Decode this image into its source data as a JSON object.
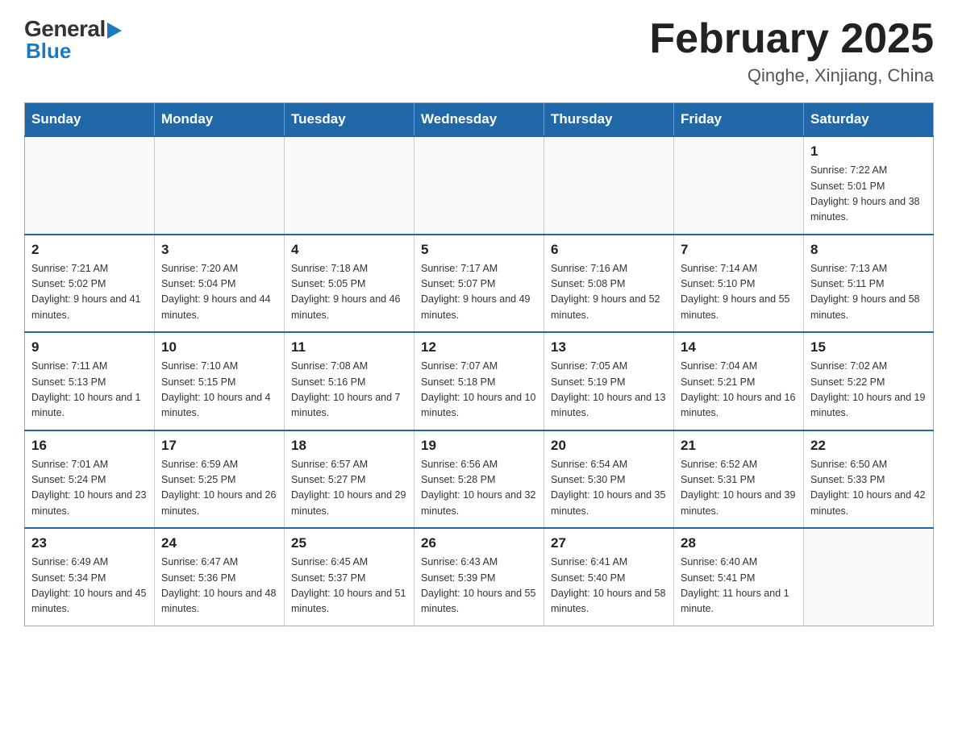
{
  "header": {
    "logo_general": "General",
    "logo_blue": "Blue",
    "title": "February 2025",
    "subtitle": "Qinghe, Xinjiang, China"
  },
  "weekdays": [
    "Sunday",
    "Monday",
    "Tuesday",
    "Wednesday",
    "Thursday",
    "Friday",
    "Saturday"
  ],
  "weeks": [
    [
      {
        "day": "",
        "info": ""
      },
      {
        "day": "",
        "info": ""
      },
      {
        "day": "",
        "info": ""
      },
      {
        "day": "",
        "info": ""
      },
      {
        "day": "",
        "info": ""
      },
      {
        "day": "",
        "info": ""
      },
      {
        "day": "1",
        "info": "Sunrise: 7:22 AM\nSunset: 5:01 PM\nDaylight: 9 hours and 38 minutes."
      }
    ],
    [
      {
        "day": "2",
        "info": "Sunrise: 7:21 AM\nSunset: 5:02 PM\nDaylight: 9 hours and 41 minutes."
      },
      {
        "day": "3",
        "info": "Sunrise: 7:20 AM\nSunset: 5:04 PM\nDaylight: 9 hours and 44 minutes."
      },
      {
        "day": "4",
        "info": "Sunrise: 7:18 AM\nSunset: 5:05 PM\nDaylight: 9 hours and 46 minutes."
      },
      {
        "day": "5",
        "info": "Sunrise: 7:17 AM\nSunset: 5:07 PM\nDaylight: 9 hours and 49 minutes."
      },
      {
        "day": "6",
        "info": "Sunrise: 7:16 AM\nSunset: 5:08 PM\nDaylight: 9 hours and 52 minutes."
      },
      {
        "day": "7",
        "info": "Sunrise: 7:14 AM\nSunset: 5:10 PM\nDaylight: 9 hours and 55 minutes."
      },
      {
        "day": "8",
        "info": "Sunrise: 7:13 AM\nSunset: 5:11 PM\nDaylight: 9 hours and 58 minutes."
      }
    ],
    [
      {
        "day": "9",
        "info": "Sunrise: 7:11 AM\nSunset: 5:13 PM\nDaylight: 10 hours and 1 minute."
      },
      {
        "day": "10",
        "info": "Sunrise: 7:10 AM\nSunset: 5:15 PM\nDaylight: 10 hours and 4 minutes."
      },
      {
        "day": "11",
        "info": "Sunrise: 7:08 AM\nSunset: 5:16 PM\nDaylight: 10 hours and 7 minutes."
      },
      {
        "day": "12",
        "info": "Sunrise: 7:07 AM\nSunset: 5:18 PM\nDaylight: 10 hours and 10 minutes."
      },
      {
        "day": "13",
        "info": "Sunrise: 7:05 AM\nSunset: 5:19 PM\nDaylight: 10 hours and 13 minutes."
      },
      {
        "day": "14",
        "info": "Sunrise: 7:04 AM\nSunset: 5:21 PM\nDaylight: 10 hours and 16 minutes."
      },
      {
        "day": "15",
        "info": "Sunrise: 7:02 AM\nSunset: 5:22 PM\nDaylight: 10 hours and 19 minutes."
      }
    ],
    [
      {
        "day": "16",
        "info": "Sunrise: 7:01 AM\nSunset: 5:24 PM\nDaylight: 10 hours and 23 minutes."
      },
      {
        "day": "17",
        "info": "Sunrise: 6:59 AM\nSunset: 5:25 PM\nDaylight: 10 hours and 26 minutes."
      },
      {
        "day": "18",
        "info": "Sunrise: 6:57 AM\nSunset: 5:27 PM\nDaylight: 10 hours and 29 minutes."
      },
      {
        "day": "19",
        "info": "Sunrise: 6:56 AM\nSunset: 5:28 PM\nDaylight: 10 hours and 32 minutes."
      },
      {
        "day": "20",
        "info": "Sunrise: 6:54 AM\nSunset: 5:30 PM\nDaylight: 10 hours and 35 minutes."
      },
      {
        "day": "21",
        "info": "Sunrise: 6:52 AM\nSunset: 5:31 PM\nDaylight: 10 hours and 39 minutes."
      },
      {
        "day": "22",
        "info": "Sunrise: 6:50 AM\nSunset: 5:33 PM\nDaylight: 10 hours and 42 minutes."
      }
    ],
    [
      {
        "day": "23",
        "info": "Sunrise: 6:49 AM\nSunset: 5:34 PM\nDaylight: 10 hours and 45 minutes."
      },
      {
        "day": "24",
        "info": "Sunrise: 6:47 AM\nSunset: 5:36 PM\nDaylight: 10 hours and 48 minutes."
      },
      {
        "day": "25",
        "info": "Sunrise: 6:45 AM\nSunset: 5:37 PM\nDaylight: 10 hours and 51 minutes."
      },
      {
        "day": "26",
        "info": "Sunrise: 6:43 AM\nSunset: 5:39 PM\nDaylight: 10 hours and 55 minutes."
      },
      {
        "day": "27",
        "info": "Sunrise: 6:41 AM\nSunset: 5:40 PM\nDaylight: 10 hours and 58 minutes."
      },
      {
        "day": "28",
        "info": "Sunrise: 6:40 AM\nSunset: 5:41 PM\nDaylight: 11 hours and 1 minute."
      },
      {
        "day": "",
        "info": ""
      }
    ]
  ]
}
